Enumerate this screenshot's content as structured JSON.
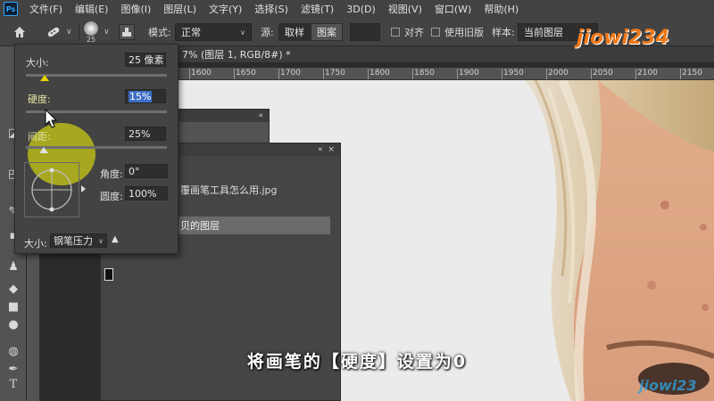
{
  "app": {
    "logo_text": "Ps"
  },
  "menu": [
    "文件(F)",
    "编辑(E)",
    "图像(I)",
    "图层(L)",
    "文字(Y)",
    "选择(S)",
    "滤镜(T)",
    "3D(D)",
    "视图(V)",
    "窗口(W)",
    "帮助(H)"
  ],
  "options": {
    "brush_size": "25",
    "mode_label": "模式:",
    "mode_value": "正常",
    "source_label": "源:",
    "sampled_label": "取样",
    "pattern_label": "图案",
    "aligned_label": "对齐",
    "legacy_label": "使用旧版",
    "sample_label": "样本:",
    "sample_value": "当前图层"
  },
  "brush_panel": {
    "size_label": "大小:",
    "size_value": "25 像素",
    "hardness_label": "硬度:",
    "hardness_value": "15%",
    "spacing_label": "间距:",
    "spacing_value": "25%",
    "angle_label": "角度:",
    "angle_value": "0°",
    "roundness_label": "圆度:",
    "roundness_value": "100%",
    "pen_size_label": "大小:",
    "pen_size_value": "钢笔压力",
    "warning_glyph": "▲"
  },
  "document": {
    "tab_label": "7% (图层 1, RGB/8#) *",
    "ruler_ticks": [
      "1600",
      "1650",
      "1700",
      "1750",
      "1800",
      "1850",
      "1900",
      "1950",
      "2000",
      "2050",
      "2100",
      "2150"
    ]
  },
  "back_panel": {
    "file_name": "覆画笔工具怎么用.jpg",
    "layer_name": "贝的图层"
  },
  "subtitle": "将画笔的【硬度】设置为0",
  "watermark": {
    "text_top": "jiowi234",
    "text_bottom": "jiowi23"
  },
  "colors": {
    "accent_highlight": "#c8c814",
    "selection_blue": "#3d6fc6"
  },
  "icons": [
    "home-icon",
    "brush-tool-icon",
    "brush-preset-icon",
    "clone-source-icon",
    "cursor-arrow-icon",
    "warning-icon"
  ]
}
